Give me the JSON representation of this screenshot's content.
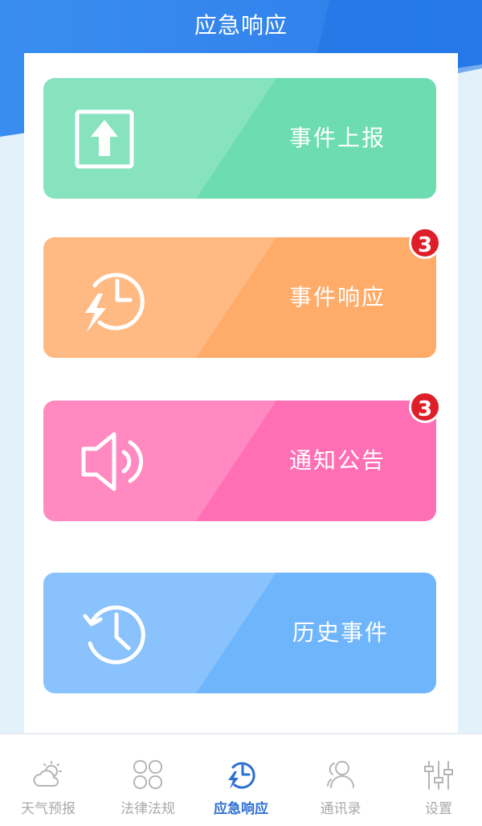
{
  "header": {
    "title": "应急响应"
  },
  "cards": [
    {
      "label": "事件上报",
      "icon": "upload-icon",
      "color": "#6ddcb0",
      "badge": null
    },
    {
      "label": "事件响应",
      "icon": "clock-lightning-icon",
      "color": "#ffab69",
      "badge": "3"
    },
    {
      "label": "通知公告",
      "icon": "speaker-icon",
      "color": "#ff6fb3",
      "badge": "3"
    },
    {
      "label": "历史事件",
      "icon": "history-icon",
      "color": "#6fb5fc",
      "badge": null
    }
  ],
  "tabs": [
    {
      "label": "天气预报",
      "icon": "weather-icon"
    },
    {
      "label": "法律法规",
      "icon": "grid-icon"
    },
    {
      "label": "应急响应",
      "icon": "emergency-icon",
      "active": true
    },
    {
      "label": "通讯录",
      "icon": "contacts-icon"
    },
    {
      "label": "设置",
      "icon": "settings-sliders-icon"
    }
  ],
  "colors": {
    "primary": "#2d7eea",
    "active_tab": "#2d6fd3",
    "badge": "#de1f2a"
  }
}
